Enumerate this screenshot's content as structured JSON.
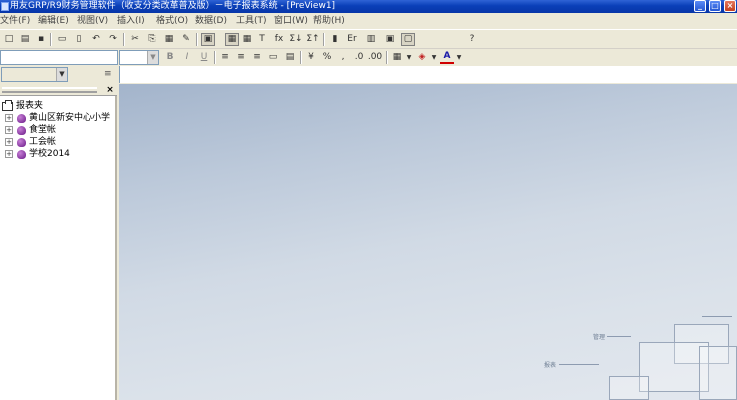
{
  "window": {
    "title": "用友GRP/R9财务管理软件（收支分类改革普及版）－电子报表系统 - [PreView1]",
    "minimize_label": "_",
    "maximize_label": "□",
    "close_label": "×"
  },
  "menubar": {
    "items": [
      "文件(F)",
      "编辑(E)",
      "视图(V)",
      "插入(I)",
      "格式(O)",
      "数据(D)",
      "工具(T)",
      "窗口(W)",
      "帮助(H)"
    ]
  },
  "toolbar1": {
    "glyphs": {
      "new": "□",
      "open": "▤",
      "save": "▪",
      "print": "▭",
      "preview": "▯",
      "undo": "↶",
      "redo": "↷",
      "cut": "✂",
      "copy": "⎘",
      "paste": "▦",
      "format_painter": "✎",
      "view1": "▣",
      "view2": "▦",
      "grid": "▦",
      "text": "T",
      "fx": "fx",
      "sum_asc": "Σ↓",
      "sum_desc": "Σ↑",
      "flag": "▮",
      "er": "Er",
      "chart": "▥",
      "pic": "▣",
      "box": "▢",
      "help": "?"
    }
  },
  "toolbar2": {
    "bold": "B",
    "italic": "I",
    "underline": "U",
    "align_left": "≡",
    "align_center": "≡",
    "align_right": "≡",
    "merge": "▭",
    "wrap": "▤",
    "currency": "¥",
    "percent": "%",
    "comma": ",",
    "inc_decimal": ".0",
    "dec_decimal": ".00",
    "borders": "▦",
    "fill_color": "◈",
    "font_color": "A"
  },
  "formula_bar": {
    "fx_symbol": "≡"
  },
  "left_panel": {
    "close_label": "×",
    "tree": [
      {
        "label": "报表夹",
        "level": 0
      },
      {
        "label": "黄山区新安中心小学",
        "level": 1
      },
      {
        "label": "食堂帐",
        "level": 1
      },
      {
        "label": "工会帐",
        "level": 1
      },
      {
        "label": "学校2014",
        "level": 1
      }
    ]
  },
  "workspace": {
    "labels": [
      "管理",
      "报表"
    ]
  },
  "colors": {
    "title_bar": "#0a3fb8",
    "chrome": "#ece9d8",
    "workspace_top": "#a3b4cb",
    "workspace_bottom": "#e2e7ee",
    "tree_icon": "#8a2aa8"
  }
}
